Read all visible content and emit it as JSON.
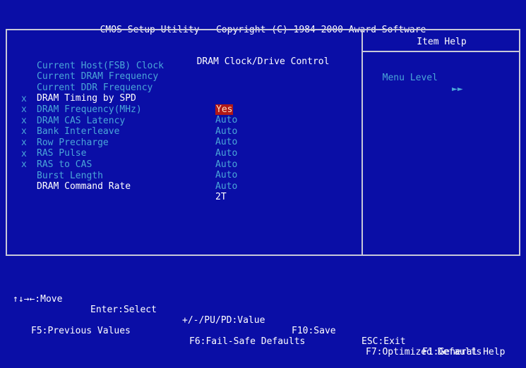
{
  "header": {
    "title": "CMOS Setup Utility - Copyright (C) 1984-2000 Award Software",
    "subtitle": "DRAM Clock/Drive Control"
  },
  "items": [
    {
      "marker": "",
      "label": "Current Host(FSB) Clock",
      "value": ""
    },
    {
      "marker": "",
      "label": "Current DRAM Frequency",
      "value": ""
    },
    {
      "marker": "",
      "label": "Current DDR Frequency",
      "value": ""
    },
    {
      "marker": "",
      "label": "DRAM Timing by SPD",
      "value": "Yes"
    },
    {
      "marker": "x",
      "label": "DRAM Frequency(MHz)",
      "value": "Auto"
    },
    {
      "marker": "x",
      "label": "DRAM CAS Latency",
      "value": "Auto"
    },
    {
      "marker": "x",
      "label": "Bank Interleave",
      "value": "Auto"
    },
    {
      "marker": "x",
      "label": "Row Precharge",
      "value": "Auto"
    },
    {
      "marker": "x",
      "label": "RAS Pulse",
      "value": "Auto"
    },
    {
      "marker": "x",
      "label": "RAS to CAS",
      "value": "Auto"
    },
    {
      "marker": "x",
      "label": "Burst Length",
      "value": "Auto"
    },
    {
      "marker": "",
      "label": "DRAM Command Rate",
      "value": "2T"
    }
  ],
  "help": {
    "title": "Item Help",
    "menu_level_label": "Menu Level",
    "menu_level_arrows": "►►"
  },
  "footer": {
    "line1": {
      "move": "↑↓→←:Move",
      "select": "Enter:Select",
      "value": "+/-/PU/PD:Value",
      "save": "F10:Save",
      "exit": "ESC:Exit",
      "help": "F1:General Help"
    },
    "line2": {
      "previous": "F5:Previous Values",
      "failsafe": "F6:Fail-Safe Defaults",
      "optimized": "F7:Optimized Defaults"
    }
  },
  "colors": {
    "background": "#0a0ea6",
    "disabled_text": "#4aa6d8",
    "active_text": "#ffffff",
    "selection_bg": "#b01818"
  }
}
